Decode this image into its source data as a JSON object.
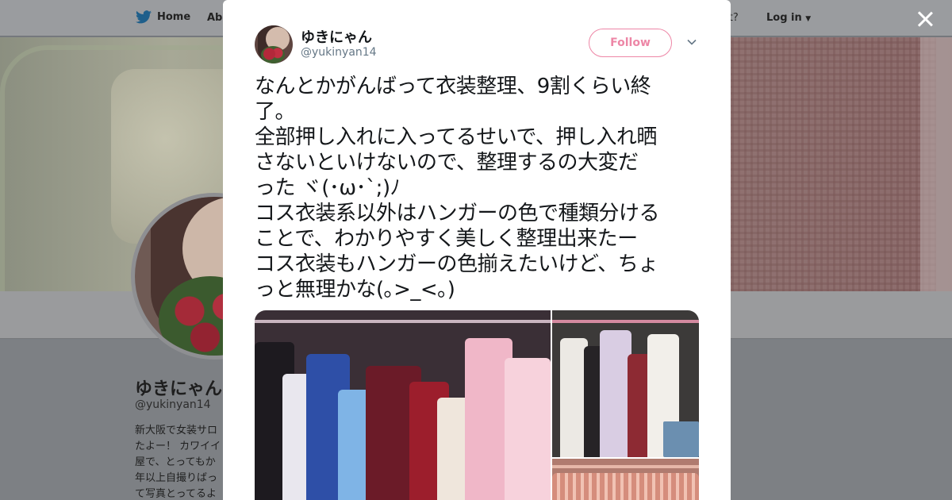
{
  "nav": {
    "home": "Home",
    "about": "Abo",
    "account_prompt": "ccount?",
    "login": "Log in"
  },
  "profile": {
    "name": "ゆきにゃん",
    "handle": "@yukinyan14",
    "bio_lines": [
      "新大阪で女装サロ",
      "たよー！ カワイイ",
      "屋で、とってもか",
      "年以上自撮りばっ",
      "て写真とってるよ"
    ]
  },
  "tweet": {
    "author_name": "ゆきにゃん",
    "author_handle": "@yukinyan14",
    "follow_label": "Follow",
    "text_lines": [
      "なんとかがんばって衣装整理、9割くらい終",
      "了。",
      "全部押し入れに入ってるせいで、押し入れ晒",
      "さないといけないので、整理するの大変だ",
      "った ヾ(･ω･`;)ﾉ",
      "コス衣装系以外はハンガーの色で種類分ける",
      "ことで、わかりやすく美しく整理出来たー",
      "コス衣装もハンガーの色揃えたいけど、ちょ",
      "っと無理かな(｡>_<｡)"
    ]
  },
  "icons": {
    "brand": "twitter-bird-icon",
    "close": "close-icon",
    "caret": "chevron-down-icon"
  },
  "colors": {
    "follow_accent": "#e0245e",
    "brand_blue": "#1da1f2",
    "text_primary": "#14171a",
    "text_secondary": "#657786"
  }
}
